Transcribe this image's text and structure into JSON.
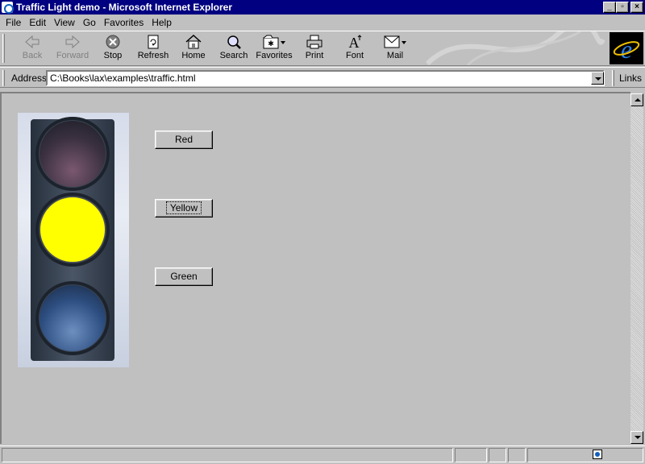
{
  "window": {
    "title": "Traffic Light demo - Microsoft Internet Explorer"
  },
  "menu": [
    "File",
    "Edit",
    "View",
    "Go",
    "Favorites",
    "Help"
  ],
  "toolbar": {
    "back": "Back",
    "forward": "Forward",
    "stop": "Stop",
    "refresh": "Refresh",
    "home": "Home",
    "search": "Search",
    "favorites": "Favorites",
    "print": "Print",
    "font": "Font",
    "mail": "Mail"
  },
  "address": {
    "label": "Address",
    "value": "C:\\Books\\lax\\examples\\traffic.html",
    "links": "Links"
  },
  "page": {
    "buttons": {
      "red": "Red",
      "yellow": "Yellow",
      "green": "Green"
    },
    "active_light": "yellow"
  },
  "colors": {
    "titlebar": "#000080",
    "chrome": "#c0c0c0",
    "lit_yellow": "#ffff00"
  }
}
